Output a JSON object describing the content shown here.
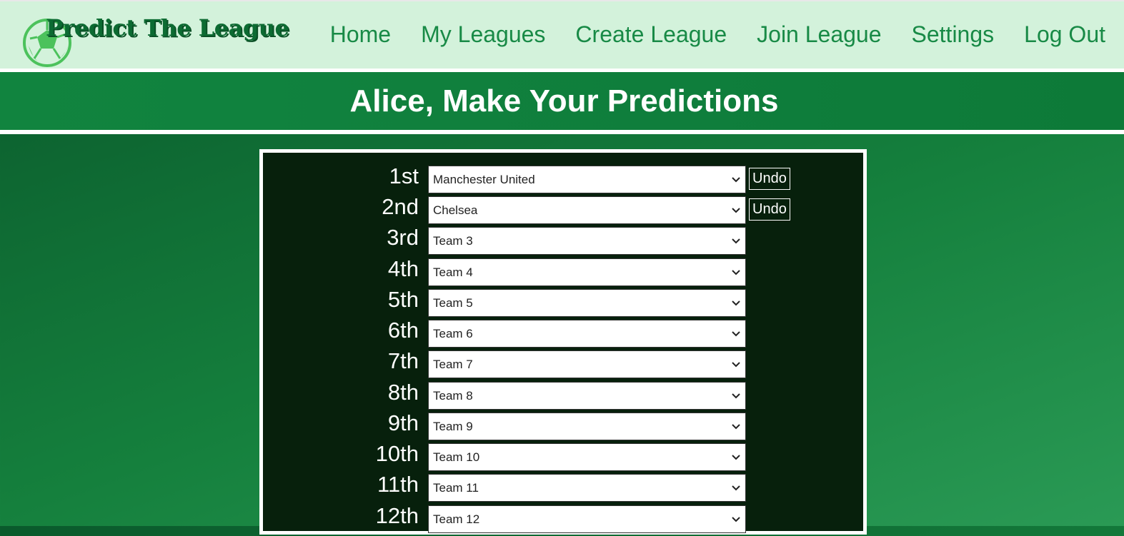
{
  "brand": {
    "name": "Predict The League"
  },
  "nav": [
    {
      "label": "Home"
    },
    {
      "label": "My Leagues"
    },
    {
      "label": "Create League"
    },
    {
      "label": "Join League"
    },
    {
      "label": "Settings"
    },
    {
      "label": "Log Out"
    }
  ],
  "page": {
    "title": "Alice, Make Your Predictions"
  },
  "undo_label": "Undo",
  "predictions": [
    {
      "position": "1st",
      "selected": "Manchester United",
      "undo": true
    },
    {
      "position": "2nd",
      "selected": "Chelsea",
      "undo": true
    },
    {
      "position": "3rd",
      "selected": "Team 3",
      "undo": false
    },
    {
      "position": "4th",
      "selected": "Team 4",
      "undo": false
    },
    {
      "position": "5th",
      "selected": "Team 5",
      "undo": false
    },
    {
      "position": "6th",
      "selected": "Team 6",
      "undo": false
    },
    {
      "position": "7th",
      "selected": "Team 7",
      "undo": false
    },
    {
      "position": "8th",
      "selected": "Team 8",
      "undo": false
    },
    {
      "position": "9th",
      "selected": "Team 9",
      "undo": false
    },
    {
      "position": "10th",
      "selected": "Team 10",
      "undo": false
    },
    {
      "position": "11th",
      "selected": "Team 11",
      "undo": false
    },
    {
      "position": "12th",
      "selected": "Team 12",
      "undo": false
    }
  ]
}
